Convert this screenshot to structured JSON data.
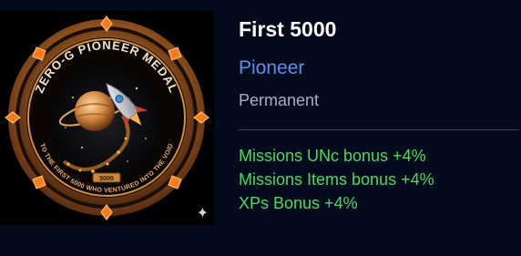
{
  "achievement": {
    "title": "First 5000",
    "rank": "Pioneer",
    "duration": "Permanent",
    "bonuses": [
      "Missions UNc bonus +4%",
      "Missions Items bonus +4%",
      "XPs Bonus +4%"
    ]
  },
  "medal": {
    "top_text": "ZERO-G PIONEER MEDAL",
    "bottom_text": "TO THE FIRST 5000 WHO VENTURED INTO THE VOID",
    "plaque_text": "5000"
  },
  "colors": {
    "background": "#020a1c",
    "title": "#ffffff",
    "rank": "#5d8ff0",
    "duration": "#a9b0bd",
    "bonus": "#4cd964",
    "divider": "#3a4357",
    "medal_gold": "#c8873a",
    "medal_orange": "#ff7a1a"
  },
  "icons": {
    "sparkle": "✦"
  }
}
